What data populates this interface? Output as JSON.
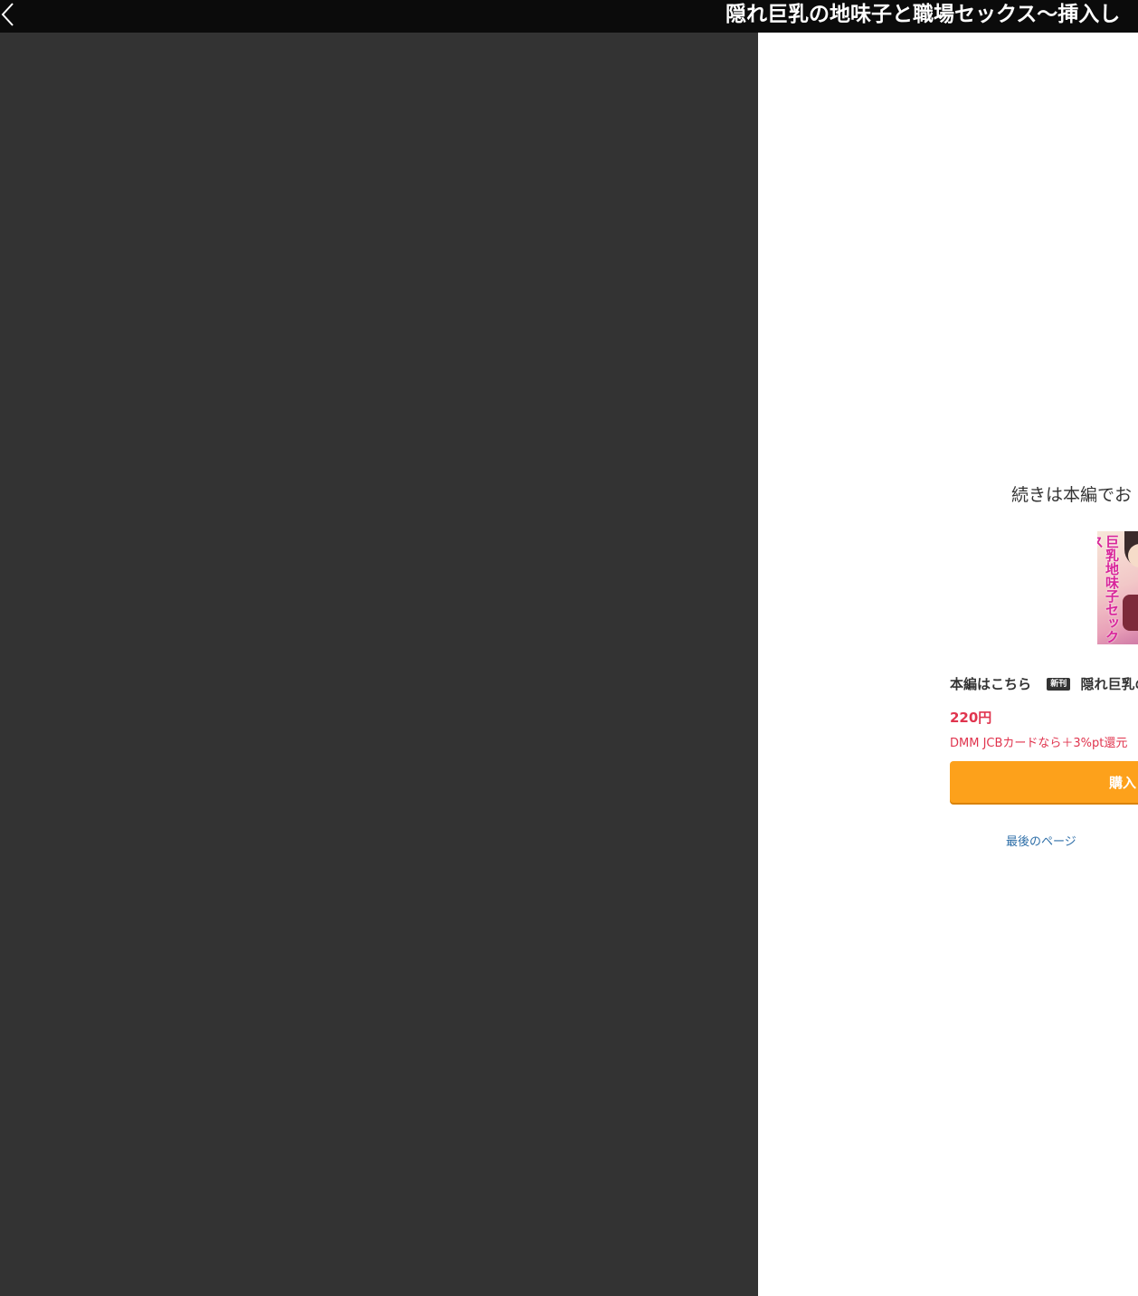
{
  "header": {
    "title": "隠れ巨乳の地味子と職場セックス〜挿入し",
    "back_icon": "chevron-left-icon"
  },
  "end_page": {
    "continue_text": "続きは本編でお",
    "cover_text": "巨乳地味子セックス",
    "honpen_label": "本編はこちら",
    "new_badge": "新刊",
    "work_title": "隠れ巨乳の",
    "price": "220円",
    "campaign": "DMM JCBカードなら＋3%pt還元",
    "buy_label": "購入",
    "last_page_link": "最後のページ"
  },
  "colors": {
    "header_bg": "#0b0b0b",
    "viewer_bg": "#333333",
    "accent_price": "#e0344e",
    "buy_button": "#fda11b",
    "link": "#2f6fa8"
  }
}
